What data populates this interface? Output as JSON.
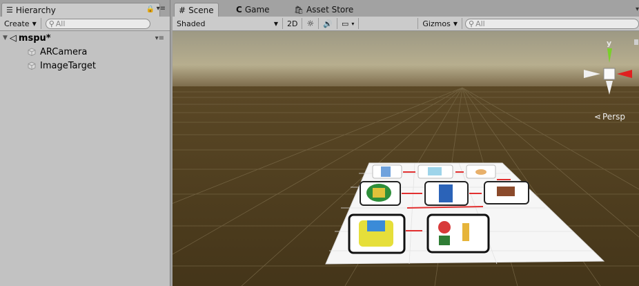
{
  "hierarchy": {
    "tab_label": "Hierarchy",
    "create_label": "Create",
    "search_placeholder": "All",
    "scene_name": "mspu*",
    "items": [
      {
        "label": "ARCamera"
      },
      {
        "label": "ImageTarget"
      }
    ]
  },
  "scene_view": {
    "tabs": [
      {
        "label": "Scene",
        "icon": "grid-icon"
      },
      {
        "label": "Game",
        "icon": "pacman-icon"
      },
      {
        "label": "Asset Store",
        "icon": "bag-icon"
      }
    ],
    "shading_mode": "Shaded",
    "mode_2d_label": "2D",
    "gizmos_label": "Gizmos",
    "search_placeholder": "All",
    "projection_label": "Persp",
    "gizmo_axis_label": "y"
  },
  "colors": {
    "panel_bg": "#c2c2c2",
    "tab_bg": "#a2a2a2",
    "ground": "#4b3a1c",
    "sky_top": "#a8a188",
    "gizmo_x": "#e02020",
    "gizmo_y": "#79d02a"
  }
}
